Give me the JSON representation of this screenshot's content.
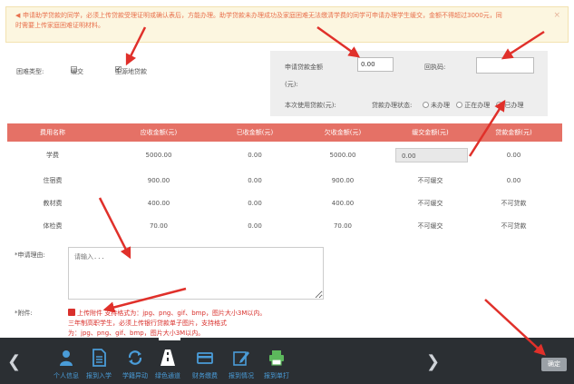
{
  "notice": {
    "lines": [
      "申请助学贷款的同学，必须上传贷款受理证明或确认表后，方能办理。助学贷款未办理成功及家庭困难无法缴清学费的同学可申请办理学生缓交，金额不得超过3000元，同",
      "时需要上传家庭困难证明材料。"
    ],
    "close": "×"
  },
  "hardship": {
    "label": "困难类型:",
    "option1": "缓交",
    "option2": "生源地贷款",
    "option2_mark": "✔"
  },
  "loan": {
    "amount_label": "申请贷款金额",
    "amount_unit": "(元):",
    "amount_value": "0.00",
    "receipt_label": "回执码:",
    "receipt_value": "",
    "status_prefix": "本次使用贷款(元):",
    "status_label": "贷款办理状态:",
    "status_options": [
      "未办理",
      "正在办理",
      "已办理"
    ]
  },
  "table": {
    "headers": [
      "费用名称",
      "应收金额(元)",
      "已收金额(元)",
      "欠收金额(元)",
      "缓交金额(元)",
      "贷款金额(元)"
    ],
    "rows": [
      [
        "学费",
        "5000.00",
        "0.00",
        "5000.00",
        "0.00",
        "0.00"
      ],
      [
        "住宿费",
        "900.00",
        "0.00",
        "900.00",
        "不可缓交",
        "0.00"
      ],
      [
        "教材费",
        "400.00",
        "0.00",
        "400.00",
        "不可缓交",
        "不可贷款"
      ],
      [
        "体检费",
        "70.00",
        "0.00",
        "70.00",
        "不可缓交",
        "不可贷款"
      ]
    ]
  },
  "reason": {
    "label": "*申请理由:",
    "placeholder": "请输入..."
  },
  "attachment": {
    "label": "*附件:",
    "line1": "上传附件 支持格式为：jpg、png、gif、bmp，图片大小3M以内。",
    "line2": "三年制高职学生，必须上传银行贷款单子图片，支持格式",
    "line3": "为：jpg、png、gif、bmp，图片大小3M以内。"
  },
  "dock": {
    "items": [
      "个人信息",
      "报到入学",
      "学籍异动",
      "绿色通道",
      "财务缴费",
      "报到情况",
      "报到单打"
    ],
    "confirm": "确定",
    "accent": "#4a9cd8",
    "bar_color": "#2b2f33"
  },
  "colors": {
    "table_header": "#e57166",
    "notice_text": "#e8704c",
    "annotation": "#e0302a"
  }
}
